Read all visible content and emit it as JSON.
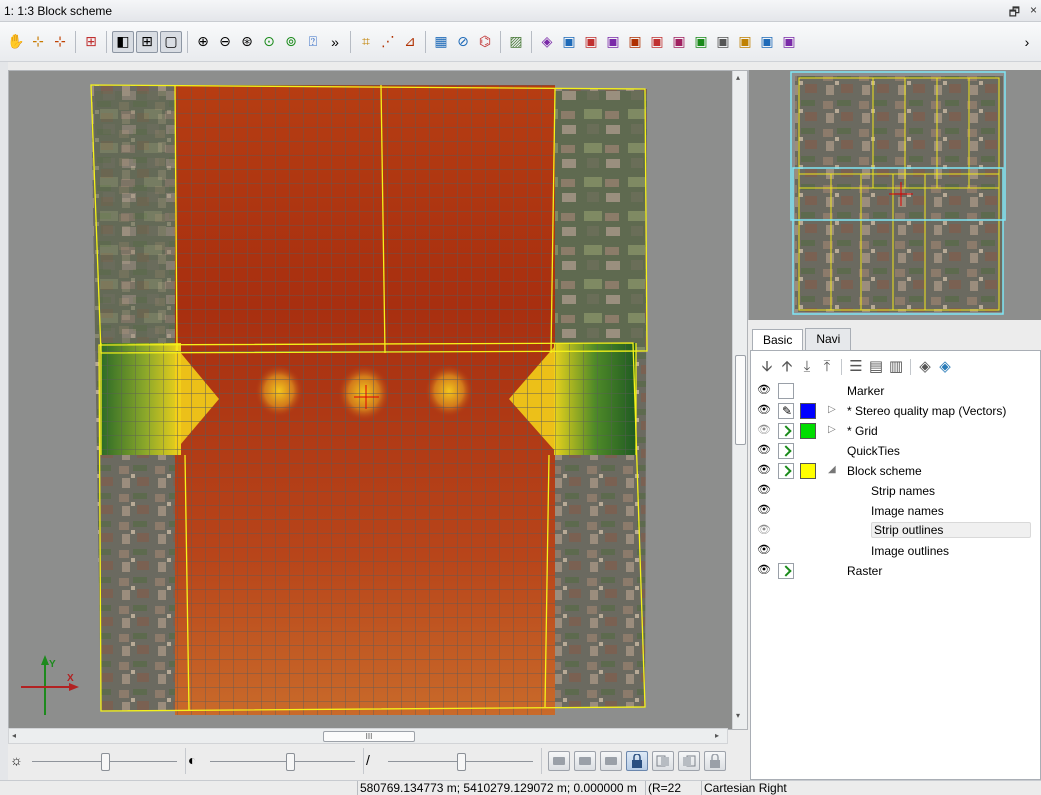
{
  "window": {
    "title": "1: 1:3 Block scheme",
    "restore_glyph": "🗗",
    "close_glyph": "×"
  },
  "toolbar": {
    "overflow_glyph": "»",
    "right_overflow_glyph": "›",
    "groups": [
      [
        "pan-hand-icon",
        "add-point-icon",
        "add-locked-point-icon"
      ],
      [
        "crosshair-icon"
      ],
      [
        "split-view-icon",
        "grid-view-icon",
        "frame-view-icon"
      ],
      [
        "zoom-in-icon",
        "zoom-out-icon",
        "zoom-extent-icon",
        "zoom-layer-icon",
        "zoom-fit-icon",
        "zoom-previous-icon"
      ],
      [
        "marker-icon",
        "select-points-icon",
        "measure-icon"
      ],
      [
        "stereo-icon",
        "orientation-icon",
        "vector-icon"
      ],
      [
        "image-icon"
      ],
      [
        "layer-tools-icon"
      ]
    ]
  },
  "sliders": {
    "brightness_glyph": "☼",
    "contrast_glyph": "◐",
    "gamma_glyph": "/",
    "brightness_value": 0.5,
    "contrast_value": 0.55,
    "gamma_value": 0.5
  },
  "status": {
    "coords": "580769.134773 m; 5410279.129072 m; 0.000000 m",
    "radius": "(R=22",
    "view_mode": "Cartesian Right"
  },
  "tabs": {
    "basic": "Basic",
    "navi": "Navi"
  },
  "layers": [
    {
      "name": "Marker",
      "checkbox": false,
      "swatch": "",
      "expand": "",
      "indent": 0,
      "selected": false
    },
    {
      "name": "* Stereo quality map (Vectors)",
      "checkbox": false,
      "pen": true,
      "swatch": "#0000ff",
      "expand": "▷",
      "indent": 0,
      "selected": false
    },
    {
      "name": "* Grid",
      "checkbox": true,
      "swatch": "#00dd00",
      "expand": "▷",
      "indent": 0,
      "selected": false
    },
    {
      "name": "QuickTies",
      "checkbox": true,
      "swatch": "",
      "expand": "",
      "indent": 0,
      "selected": false
    },
    {
      "name": "Block scheme",
      "checkbox": true,
      "swatch": "#ffff00",
      "expand": "◢",
      "indent": 0,
      "selected": false
    },
    {
      "name": "Strip names",
      "checkbox": false,
      "swatch": "",
      "expand": "",
      "indent": 1,
      "selected": false
    },
    {
      "name": "Image names",
      "checkbox": false,
      "swatch": "",
      "expand": "",
      "indent": 1,
      "selected": false
    },
    {
      "name": "Strip outlines",
      "checkbox": false,
      "swatch": "",
      "expand": "",
      "indent": 1,
      "selected": true
    },
    {
      "name": "Image outlines",
      "checkbox": false,
      "swatch": "",
      "expand": "",
      "indent": 1,
      "selected": false
    },
    {
      "name": "Raster",
      "checkbox": true,
      "swatch": "",
      "expand": "",
      "indent": 0,
      "selected": false
    }
  ],
  "axis": {
    "y": "Y",
    "x": "X"
  },
  "scroll": {
    "thumb_glyph": "III",
    "left": "◂",
    "right": "▸",
    "up": "▴",
    "down": "▾"
  },
  "colors": {
    "accent": "#316ac5",
    "outline_yellow": "#ffff00",
    "overview_cyan": "#7fe6f5"
  }
}
